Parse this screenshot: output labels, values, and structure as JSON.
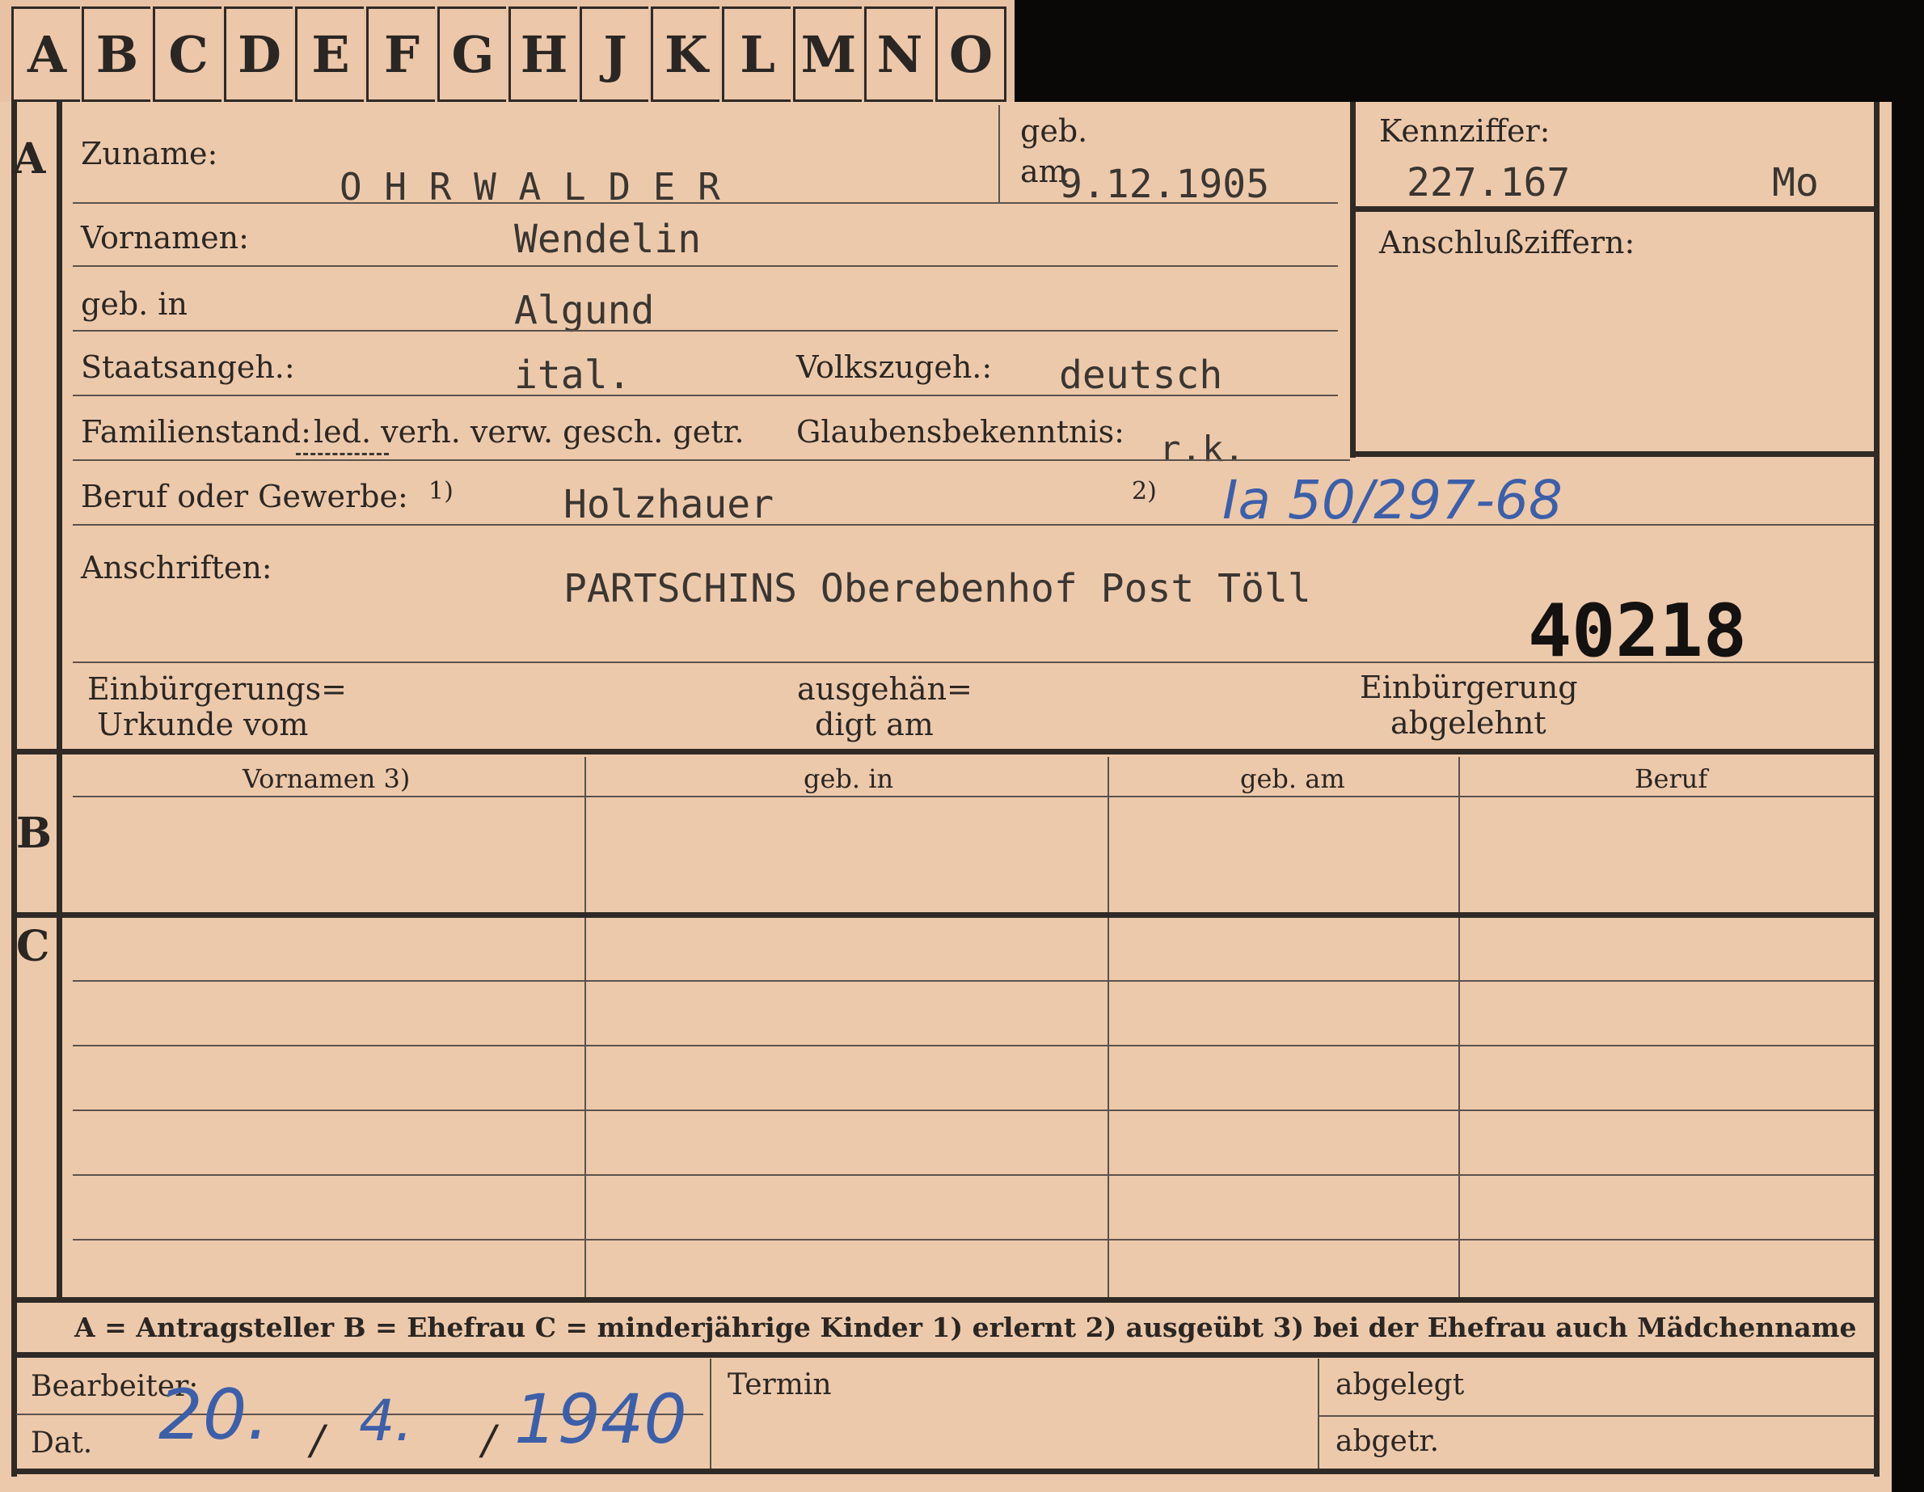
{
  "tabs": [
    "A",
    "B",
    "C",
    "D",
    "E",
    "F",
    "G",
    "H",
    "J",
    "K",
    "L",
    "M",
    "N",
    "O"
  ],
  "sections": {
    "a": "A",
    "b": "B",
    "c": "C"
  },
  "fields": {
    "zuname_label": "Zuname:",
    "zuname_value": "O H R W A L D E R",
    "geb_am_label_top": "geb.",
    "geb_am_label_bottom": "am",
    "geb_am_value": "9.12.1905",
    "kennziffer_label": "Kennziffer:",
    "kennziffer_value": "227.167",
    "kennziffer_suffix": "Mo",
    "anschluss_label": "Anschlußziffern:",
    "vornamen_label": "Vornamen:",
    "vornamen_value": "Wendelin",
    "geb_in_label": "geb. in",
    "geb_in_value": "Algund",
    "staatsangeh_label": "Staatsangeh.:",
    "staatsangeh_value": "ital.",
    "volkszugeh_label": "Volkszugeh.:",
    "volkszugeh_value": "deutsch",
    "familienstand_label": "Familienstand:",
    "familienstand_options": "led. verh. verw. gesch. getr.",
    "glaubens_label": "Glaubensbekenntnis:",
    "glaubens_value": "r.k.",
    "beruf_label": "Beruf oder Gewerbe:",
    "beruf_note1": "1)",
    "beruf_value": "Holzhauer",
    "beruf_note2": "2)",
    "beruf_handwritten": "Ia 50/297-68",
    "anschriften_label": "Anschriften:",
    "anschriften_value": "PARTSCHINS Oberebenhof Post Töll",
    "stamp_number": "40218",
    "einb_label_1": "Einbürgerungs=",
    "einb_label_2": "Urkunde vom",
    "ausgeh_label_1": "ausgehän=",
    "ausgeh_label_2": "digt am",
    "abgelehnt_label_1": "Einbürgerung",
    "abgelehnt_label_2": "abgelehnt"
  },
  "table": {
    "headers": [
      "Vornamen 3)",
      "geb. in",
      "geb. am",
      "Beruf"
    ]
  },
  "legend": "A = Antragsteller   B = Ehefrau   C = minderjährige Kinder   1) erlernt   2) ausgeübt   3) bei der Ehefrau auch Mädchenname",
  "footer": {
    "bearbeiter_label": "Bearbeiter:",
    "dat_label": "Dat.",
    "date_day": "20.",
    "date_month": "4.",
    "date_year": "1940",
    "date_sep": "/",
    "termin_label": "Termin",
    "abgelegt_label": "abgelegt",
    "abgetr_label": "abgetr."
  },
  "colors": {
    "card": "#edc9ab",
    "ink": "#2a2623",
    "handwriting": "#3d5fa8",
    "background": "#0a0806"
  }
}
